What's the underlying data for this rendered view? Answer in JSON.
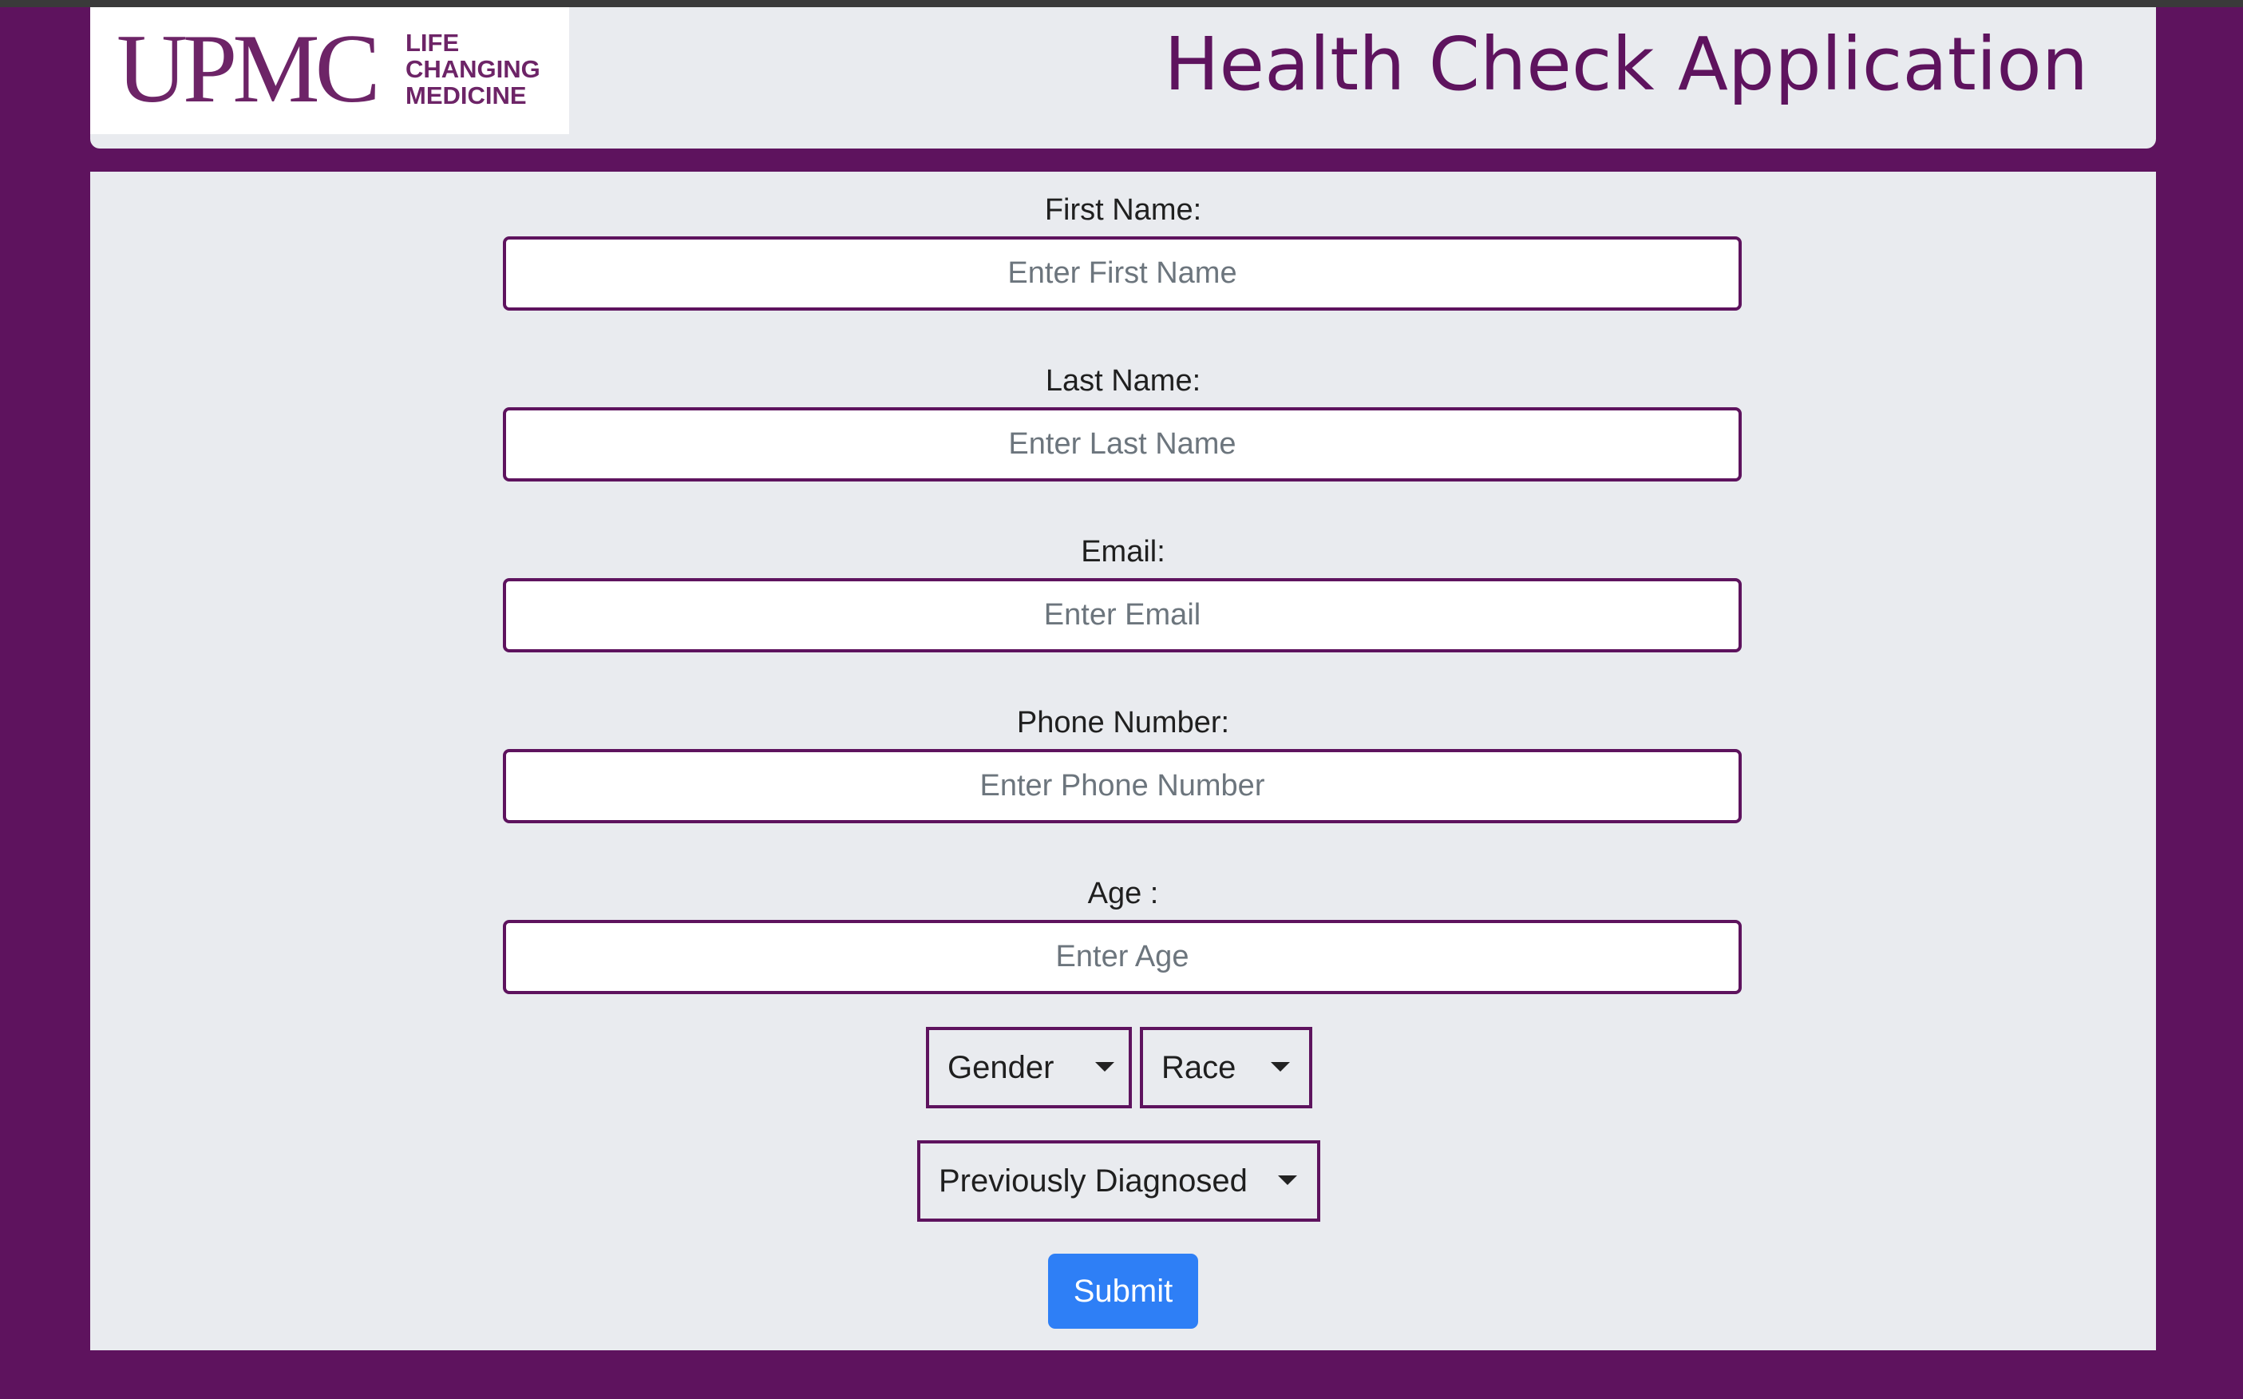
{
  "header": {
    "logo": {
      "mark": "UPMC",
      "tagline": [
        "LIFE",
        "CHANGING",
        "MEDICINE"
      ]
    },
    "title": "Health Check Application"
  },
  "form": {
    "first_name": {
      "label": "First Name:",
      "placeholder": "Enter First Name",
      "value": ""
    },
    "last_name": {
      "label": "Last Name:",
      "placeholder": "Enter Last Name",
      "value": ""
    },
    "email": {
      "label": "Email:",
      "placeholder": "Enter Email",
      "value": ""
    },
    "phone": {
      "label": "Phone Number:",
      "placeholder": "Enter Phone Number",
      "value": ""
    },
    "age": {
      "label": "Age :",
      "placeholder": "Enter Age",
      "value": ""
    },
    "gender_dropdown": {
      "label": "Gender",
      "icon": "caret-down-icon"
    },
    "race_dropdown": {
      "label": "Race",
      "icon": "caret-down-icon"
    },
    "diagnosed_dropdown": {
      "label": "Previously Diagnosed",
      "icon": "caret-down-icon"
    },
    "submit_label": "Submit"
  },
  "colors": {
    "page_background": "#5e135e",
    "panel_background": "#e9ebef",
    "brand_purple": "#6d2467",
    "input_border": "#5e135e",
    "submit_button": "#2e7ff6"
  }
}
